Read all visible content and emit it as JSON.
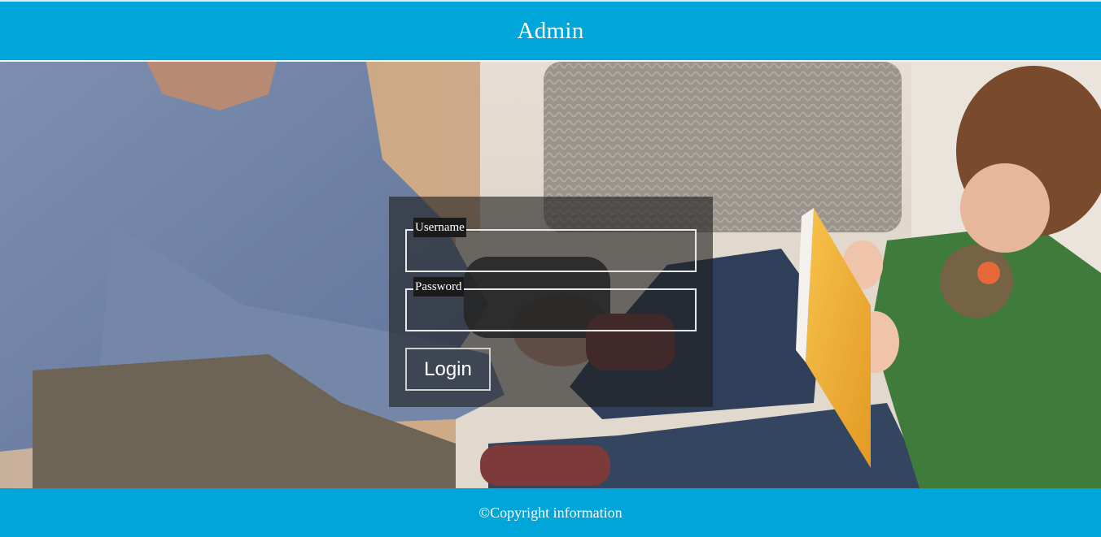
{
  "header": {
    "title": "Admin"
  },
  "login": {
    "username_label": "Username",
    "username_value": "",
    "password_label": "Password",
    "password_value": "",
    "button_label": "Login"
  },
  "footer": {
    "copyright": "©Copyright information"
  },
  "colors": {
    "brand": "#00a5d9",
    "panel": "rgba(30,30,30,0.62)",
    "text": "#ffffff"
  }
}
